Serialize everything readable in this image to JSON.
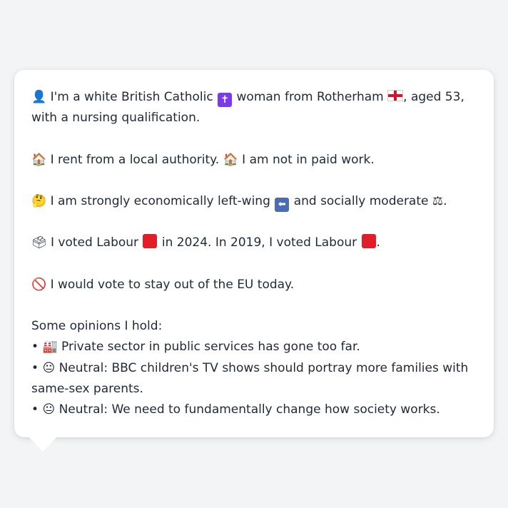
{
  "card": {
    "identity": {
      "icon": "👤",
      "text_before_religion": "I'm a white British Catholic",
      "religion_icon": "✝",
      "text_before_flag": "woman from Rotherham",
      "text_after_flag": ", aged 53, with a nursing qualification."
    },
    "housing": {
      "icon1": "🏠",
      "text1": "I rent from a local authority.",
      "icon2": "🏠",
      "text2": "I am not in paid work."
    },
    "economics": {
      "icon": "🤔",
      "text_before_arrow": "I am strongly economically left-wing",
      "arrow_icon": "⬅",
      "text_between": "and socially moderate",
      "scales_icon": "⚖",
      "text_end": "."
    },
    "votes": {
      "icon": "🗳",
      "text1": "I voted Labour",
      "text2": "in 2024. In 2019, I voted Labour",
      "text3": "."
    },
    "eu": {
      "icon": "🚫",
      "text": "I would vote to stay out of the EU today."
    },
    "opinions": {
      "heading": "Some opinions I hold:",
      "items": [
        {
          "bullet": "•",
          "icon": "🏭",
          "text": "Private sector in public services has gone too far."
        },
        {
          "bullet": "•",
          "icon": "😐",
          "text": "Neutral: BBC children's TV shows should portray more families with same-sex parents."
        },
        {
          "bullet": "•",
          "icon": "😐",
          "text": "Neutral: We need to fundamentally change how society works."
        }
      ]
    },
    "colors": {
      "labour_red": "#e11d27",
      "background": "#f3f4f6",
      "card": "#ffffff",
      "text": "#1f2937"
    }
  }
}
